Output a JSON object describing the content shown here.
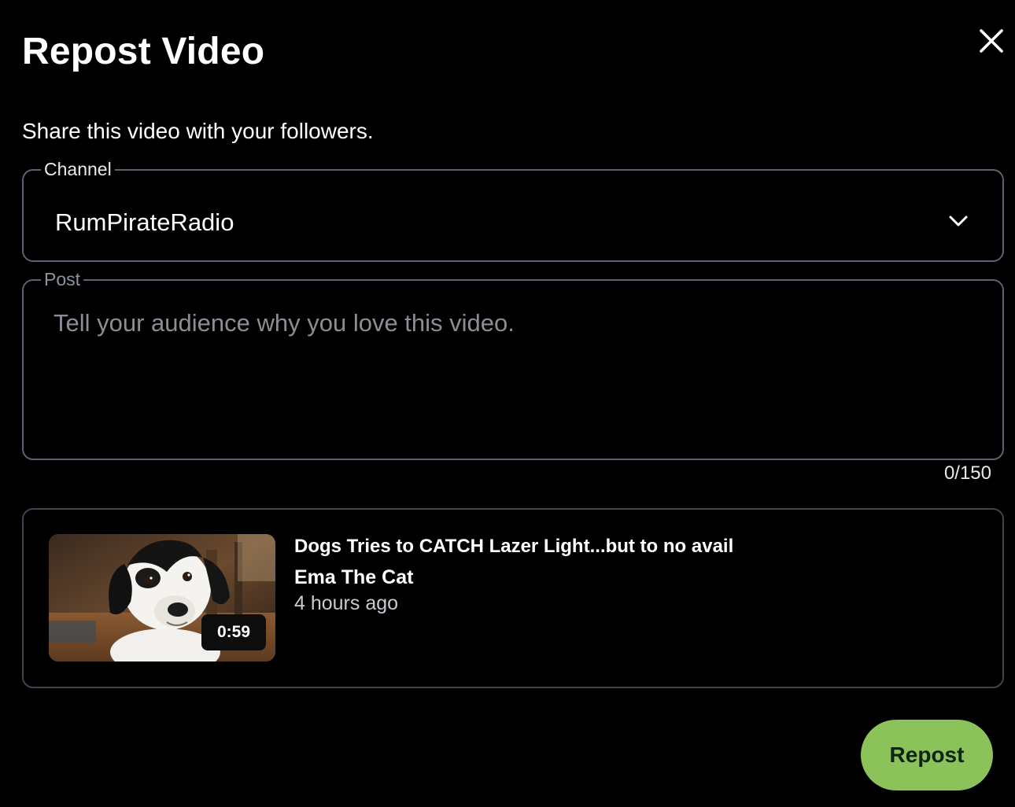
{
  "modal": {
    "title": "Repost Video",
    "subtitle": "Share this video with your followers."
  },
  "icons": {
    "close": "close-icon",
    "dropdown": "chevron-down-icon"
  },
  "channel_field": {
    "label": "Channel",
    "selected": "RumPirateRadio"
  },
  "post_field": {
    "label": "Post",
    "placeholder": "Tell your audience why you love this video.",
    "value": "",
    "char_count": "0/150"
  },
  "video": {
    "title": "Dogs Tries to CATCH Lazer Light...but to no avail",
    "channel": "Ema The Cat",
    "posted": "4 hours ago",
    "duration": "0:59"
  },
  "actions": {
    "repost_label": "Repost"
  },
  "colors": {
    "background": "#000000",
    "field_border": "#5b6270",
    "card_border": "#3f4450",
    "accent": "#8bc25a",
    "placeholder": "#8b8e94"
  }
}
